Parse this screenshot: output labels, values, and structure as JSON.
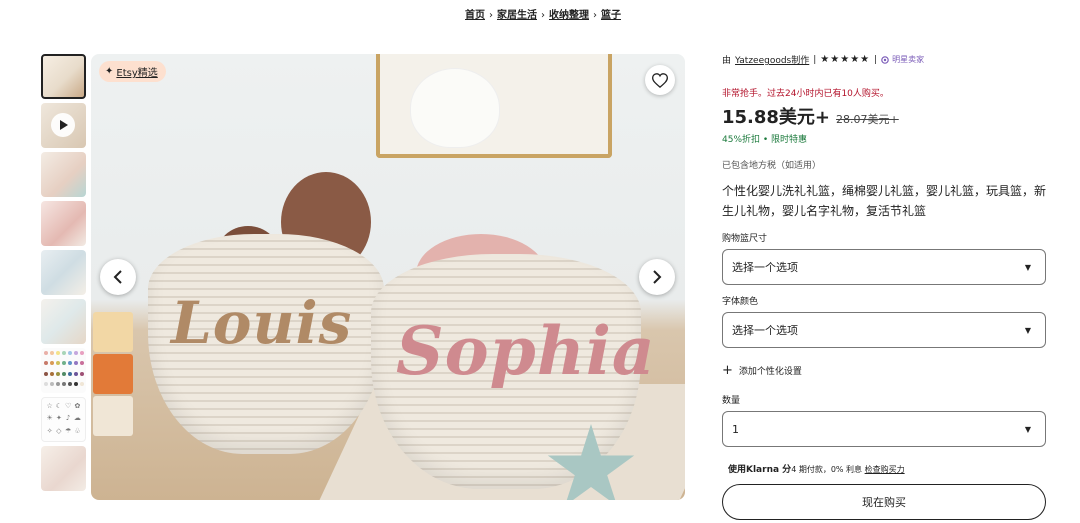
{
  "breadcrumb": [
    "首页",
    "家居生活",
    "收纳整理",
    "篮子"
  ],
  "gallery": {
    "badge_label": "Etsy精选",
    "favorite_icon": "heart-icon",
    "prev_icon": "chevron-left-icon",
    "next_icon": "chevron-right-icon",
    "thumbnail_count": 9,
    "name_left": "Louis",
    "name_right": "Sophia"
  },
  "seller": {
    "prefix": "由",
    "shop_name": "Yatzeegoods制作",
    "rating_stars": 5,
    "stars_text": "★★★★★",
    "star_seller_label": "明星卖家"
  },
  "urgency_text": "非常抢手。过去24小时内已有10人购买。",
  "price": {
    "current": "15.88美元+",
    "original": "28.07美元+",
    "discount": "45%折扣 • 限时特惠"
  },
  "tax_note": "已包含地方税（如适用）",
  "product_title": "个性化婴儿洗礼礼篮，绳棉婴儿礼篮，婴儿礼篮，玩具篮，新生儿礼物，婴儿名字礼物，复活节礼篮",
  "options": {
    "size_label": "购物篮尺寸",
    "size_value": "选择一个选项",
    "font_color_label": "字体颜色",
    "font_color_value": "选择一个选项",
    "personalize_label": "添加个性化设置",
    "quantity_label": "数量",
    "quantity_value": "1"
  },
  "klarna": {
    "bold": "使用Klarna 分",
    "text": "4 期付款，0% 利息",
    "link": "检查购买力"
  },
  "buy_button": "现在购买",
  "colors": {
    "accent_red": "#b3132b",
    "discount_green": "#1b7a3c",
    "star_seller_purple": "#7b5cb8",
    "badge_bg": "#fde0cf"
  }
}
